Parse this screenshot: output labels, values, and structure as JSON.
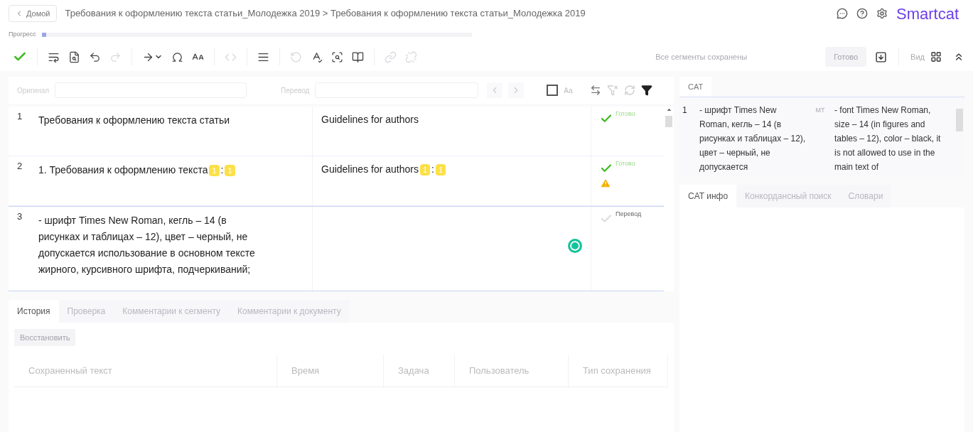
{
  "header": {
    "back_button": "Домой",
    "breadcrumb": "Требования к оформлению текста статьи_Молодежка 2019 > Требования к оформлению текста статьи_Молодежка 2019",
    "logo": "Smartcat"
  },
  "progress": {
    "label": "Прогресс",
    "level": 0.01
  },
  "toolbar": {
    "items": [
      {
        "disabled": false
      },
      {
        "disabled": false
      },
      {
        "disabled": false
      },
      {
        "disabled": false
      },
      {
        "disabled": true
      },
      {
        "disabled": false
      },
      {
        "disabled": false
      },
      {
        "disabled": false
      },
      {
        "disabled": true
      },
      {
        "disabled": false
      },
      {
        "disabled": true
      },
      {
        "disabled": false
      },
      {
        "disabled": false
      },
      {
        "disabled": false
      },
      {
        "disabled": true
      },
      {
        "disabled": true
      }
    ],
    "save_status": "Все сегменты сохранены",
    "done_button": "Готово",
    "view_label": "Вид"
  },
  "filter": {
    "source_label": "Оригинал",
    "target_label": "Перевод",
    "match_case": {
      "checked": false,
      "label": "Aa"
    }
  },
  "segments": [
    {
      "number": "1",
      "source": [
        {
          "kind": "text",
          "text": "Требования к оформлению текста статьи"
        }
      ],
      "target": [
        {
          "kind": "text",
          "text": "Guidelines for authors"
        }
      ],
      "confirmed": true,
      "status": "Готово",
      "warning": false,
      "active": false
    },
    {
      "number": "2",
      "source": [
        {
          "kind": "text",
          "text": "1. Требования к оформлению текста"
        },
        {
          "kind": "tag",
          "text": "1"
        },
        {
          "kind": "text",
          "text": ":"
        },
        {
          "kind": "tag",
          "text": "1"
        }
      ],
      "target": [
        {
          "kind": "text",
          "text": "Guidelines for authors"
        },
        {
          "kind": "tag",
          "text": "1"
        },
        {
          "kind": "text",
          "text": ":"
        },
        {
          "kind": "tag",
          "text": "1"
        }
      ],
      "confirmed": true,
      "status": "Готово",
      "warning": true,
      "active": false
    },
    {
      "number": "3",
      "source": [
        {
          "kind": "text",
          "text": "- шрифт Times New Roman, кегль – 14 (в рисунках и таблицах – 12), цвет – черный, не допускается использование в основном тексте жирного, курсивного шрифта, подчеркиваний;"
        }
      ],
      "confirmed": false,
      "status": "Перевод",
      "warning": false,
      "active": true
    }
  ],
  "bottom_tabs": [
    {
      "label": "История",
      "selected": true
    },
    {
      "label": "Проверка",
      "selected": false
    },
    {
      "label": "Комментарии к сегменту",
      "selected": false
    },
    {
      "label": "Комментарии к документу",
      "selected": false
    }
  ],
  "restore_button": "Восстановить",
  "history_table": {
    "columns": [
      "Сохраненный текст",
      "Время",
      "Задача",
      "Пользователь",
      "Тип сохранения"
    ]
  },
  "cat_tab": "CAT",
  "cat_matches": [
    {
      "number": "1",
      "source": "- шрифт Times New Roman, кегль – 14 (в рисунках и таблицах – 12), цвет – черный, не допускается",
      "type": "MT",
      "target": "- font Times New Roman, size – 14 (in figures and tables – 12), color – black, it is not allowed to use in the main text of"
    }
  ],
  "info_tabs": [
    {
      "label": "CAT инфо",
      "selected": true
    },
    {
      "label": "Конкордансный поиск",
      "selected": false
    },
    {
      "label": "Словари",
      "selected": false
    }
  ]
}
